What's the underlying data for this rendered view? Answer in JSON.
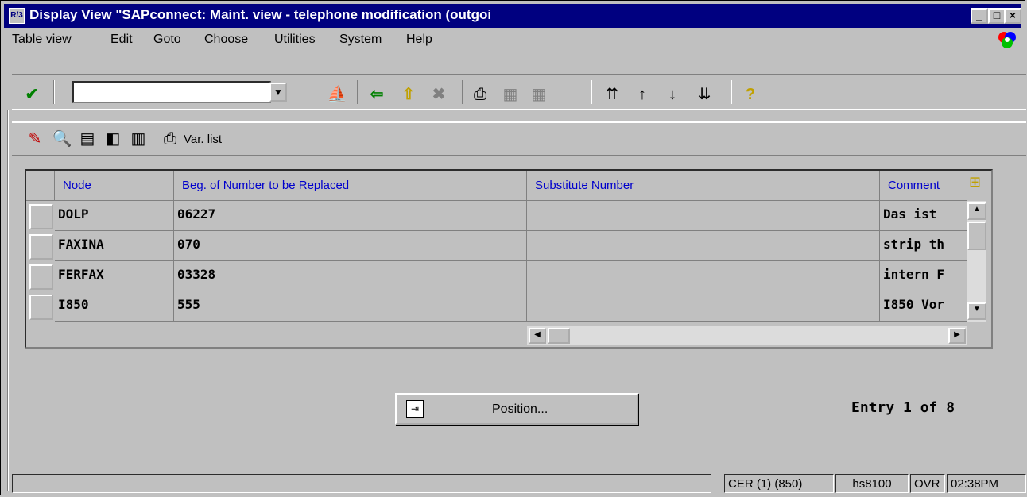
{
  "window": {
    "title": "Display View \"SAPconnect: Maint. view - telephone modification (outgoi",
    "sys_icon": "R/3",
    "minimize": "_",
    "maximize": "□",
    "close": "×"
  },
  "menu": {
    "items": [
      {
        "label": "Table view"
      },
      {
        "label": "Edit"
      },
      {
        "label": "Goto"
      },
      {
        "label": "Choose"
      },
      {
        "label": "Utilities"
      },
      {
        "label": "System"
      },
      {
        "label": "Help"
      }
    ]
  },
  "toolbar": {
    "command_field_value": "",
    "icons": [
      "check-icon",
      "back-icon",
      "exit-icon",
      "cancel-icon",
      "print-icon",
      "find-icon",
      "find-next-icon",
      "first-page-icon",
      "previous-page-icon",
      "next-page-icon",
      "last-page-icon",
      "help-icon"
    ]
  },
  "app_toolbar": {
    "var_list_label": "Var. list"
  },
  "table": {
    "headers": {
      "node": "Node",
      "begin_number": "Beg. of Number to be Replaced",
      "substitute": "Substitute Number",
      "comment": "Comment"
    },
    "rows": [
      {
        "node": "DOLP",
        "begin_number": "06227",
        "substitute": "",
        "comment": "Das ist"
      },
      {
        "node": "FAXINA",
        "begin_number": "070",
        "substitute": "",
        "comment": "strip th"
      },
      {
        "node": "FERFAX",
        "begin_number": "03328",
        "substitute": "",
        "comment": "intern F"
      },
      {
        "node": "I850",
        "begin_number": "555",
        "substitute": "",
        "comment": "I850 Vor"
      }
    ]
  },
  "position_button": {
    "label": "Position..."
  },
  "entry_info": "Entry 1 of 8",
  "status": {
    "system": "CER (1) (850)",
    "server": "hs8100",
    "mode": "OVR",
    "time": "02:38PM"
  },
  "colors": {
    "title_bar": "#000080",
    "window_bg": "#c0c0c0",
    "header_text": "#0000cc"
  }
}
